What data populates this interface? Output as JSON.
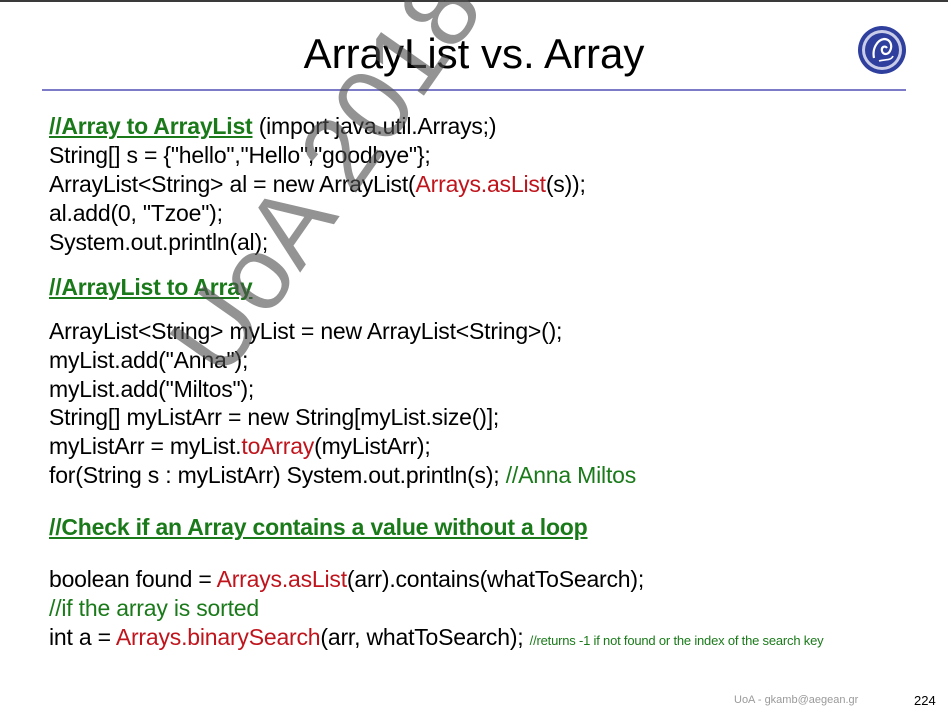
{
  "slide": {
    "title": "ArrayList vs. Array",
    "watermark": "UoA 2018-19",
    "footer": "UoA - gkamb@aegean.gr",
    "page_number": "224"
  },
  "section1": {
    "heading": "//Array to ArrayList",
    "heading_note": " (import java.util.Arrays;)",
    "line1": "String[] s = {\"hello\",\"Hello\",\"goodbye\"};",
    "line2_pre": "ArrayList<String> al = new ArrayList(",
    "line2_red": "Arrays.asList",
    "line2_post": "(s));",
    "line3": "al.add(0, \"Tzoe\");",
    "line4": "System.out.println(al);"
  },
  "section2": {
    "heading": "//ArrayList to Array",
    "line1": "ArrayList<String> myList = new ArrayList<String>();",
    "line2": "myList.add(\"Anna\");",
    "line3": "myList.add(\"Miltos\");",
    "line4": "String[] myListArr = new String[myList.size()];",
    "line5_pre": "myListArr = myList.",
    "line5_red": "toArray",
    "line5_post": "(myListArr);",
    "line6_pre": "for(String s : myListArr) System.out.println(s); ",
    "line6_comment": "//Anna Miltos"
  },
  "section3": {
    "heading": "//Check if an Array contains a value without a loop",
    "line1_pre": "boolean found = ",
    "line1_red": "Arrays.asList",
    "line1_post": "(arr).contains(whatToSearch);",
    "line2_comment": "//if the array is sorted",
    "line3_pre": "int a =  ",
    "line3_red": "Arrays.binarySearch",
    "line3_post": "(arr, whatToSearch); ",
    "line3_comment": "//returns -1 if not found or the index of the search key"
  }
}
